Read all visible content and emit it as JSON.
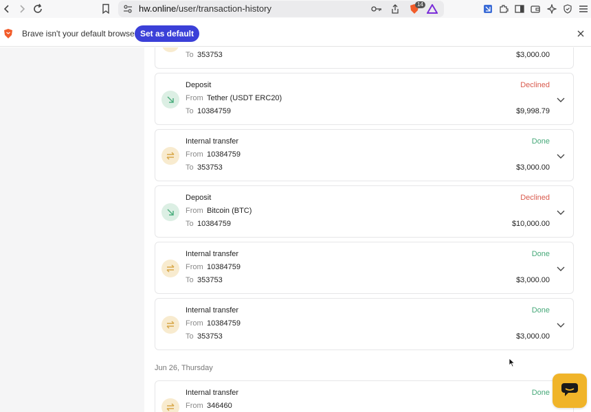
{
  "browser": {
    "url_host": "hw.online",
    "url_path": "/user/transaction-history",
    "shields_count": "14"
  },
  "infobar": {
    "message": "Brave isn't your default browser",
    "set_default_label": "Set as default"
  },
  "labels": {
    "from": "From",
    "to": "To"
  },
  "transactions": [
    {
      "type": "",
      "status": "",
      "status_kind": "",
      "from": "",
      "to": "353753",
      "amount": "$3,000.00",
      "icon": "transfer-icon"
    },
    {
      "type": "Deposit",
      "status": "Declined",
      "status_kind": "declined",
      "from": "Tether (USDT ERC20)",
      "to": "10384759",
      "amount": "$9,998.79",
      "icon": "deposit-arrow-icon"
    },
    {
      "type": "Internal transfer",
      "status": "Done",
      "status_kind": "done",
      "from": "10384759",
      "to": "353753",
      "amount": "$3,000.00",
      "icon": "transfer-icon"
    },
    {
      "type": "Deposit",
      "status": "Declined",
      "status_kind": "declined",
      "from": "Bitcoin (BTC)",
      "to": "10384759",
      "amount": "$10,000.00",
      "icon": "deposit-arrow-icon"
    },
    {
      "type": "Internal transfer",
      "status": "Done",
      "status_kind": "done",
      "from": "10384759",
      "to": "353753",
      "amount": "$3,000.00",
      "icon": "transfer-icon"
    },
    {
      "type": "Internal transfer",
      "status": "Done",
      "status_kind": "done",
      "from": "10384759",
      "to": "353753",
      "amount": "$3,000.00",
      "icon": "transfer-icon"
    }
  ],
  "date_group": "Jun 26, Thursday",
  "next_transaction": {
    "type": "Internal transfer",
    "status": "Done",
    "from": "346460"
  },
  "colors": {
    "done": "#45a878",
    "declined": "#d9594c",
    "set_default_bg": "#3b40d8",
    "chat_button": "#f0b429",
    "transfer_icon_bg": "#f8ebcf",
    "deposit_icon_bg": "#dcefe4"
  }
}
